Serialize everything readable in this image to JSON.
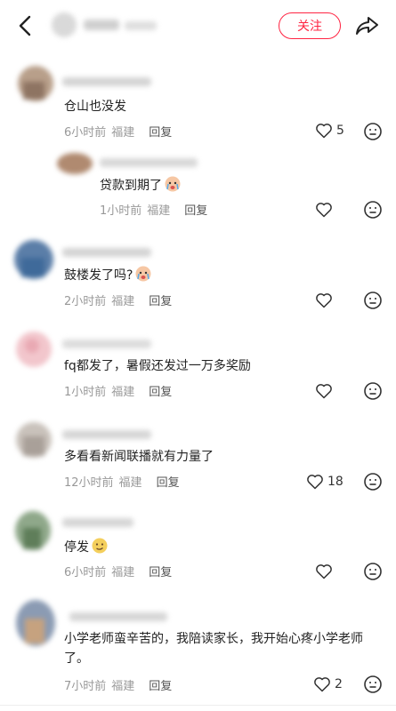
{
  "header": {
    "follow_label": "关注"
  },
  "comments": [
    {
      "text": "仓山也没发",
      "time": "6小时前",
      "location": "福建",
      "reply": "回复",
      "likes": "5"
    },
    {
      "text": "贷款到期了",
      "time": "1小时前",
      "location": "福建",
      "reply": "回复",
      "likes": ""
    },
    {
      "text": "鼓楼发了吗?",
      "time": "2小时前",
      "location": "福建",
      "reply": "回复",
      "likes": ""
    },
    {
      "text": "fq都发了，暑假还发过一万多奖励",
      "time": "1小时前",
      "location": "福建",
      "reply": "回复",
      "likes": ""
    },
    {
      "text": "多看看新闻联播就有力量了",
      "time": "12小时前",
      "location": "福建",
      "reply": "回复",
      "likes": "18"
    },
    {
      "text": "停发",
      "time": "6小时前",
      "location": "福建",
      "reply": "回复",
      "likes": ""
    },
    {
      "text": "小学老师蛮辛苦的，我陪读家长，我开始心疼小学老师了。",
      "time": "7小时前",
      "location": "福建",
      "reply": "回复",
      "likes": "2"
    }
  ],
  "icons": {
    "back": "chevron-left-icon",
    "share": "share-arrow-icon",
    "like": "heart-outline-icon",
    "emoji": "emoji-face-icon",
    "crying": "crying-emoji-icon",
    "smirk": "smirk-emoji-icon"
  },
  "colors": {
    "accent": "#ff2442",
    "meta": "#999999",
    "text": "#222222"
  }
}
